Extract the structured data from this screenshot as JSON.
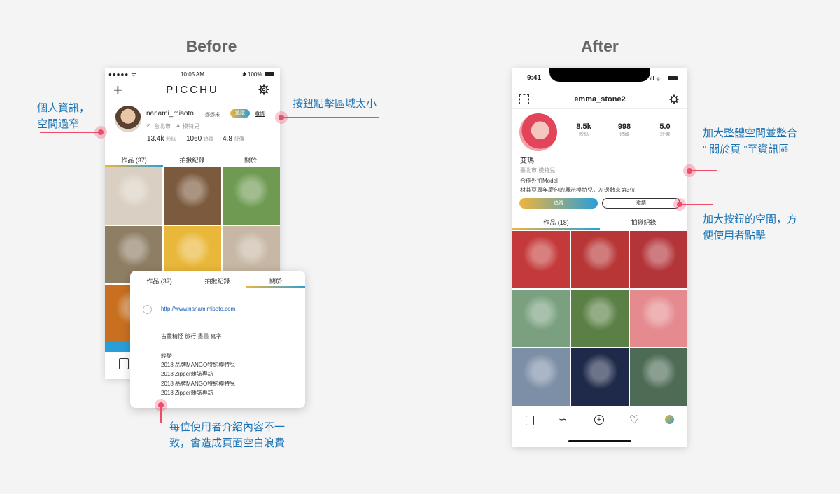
{
  "headings": {
    "before": "Before",
    "after": "After"
  },
  "before": {
    "status_time": "10:05 AM",
    "status_battery": "100%",
    "app_title": "PICCHU",
    "username": "nanami_misoto",
    "nickname": "娜娜米",
    "follow_label": "追蹤",
    "invite_label": "邀請",
    "location": "台北市",
    "role": "模特兒",
    "stats": [
      {
        "value": "13.4k",
        "label": "粉絲"
      },
      {
        "value": "1060",
        "label": "追蹤"
      },
      {
        "value": "4.8",
        "label": "評價"
      }
    ],
    "tabs": [
      "作品 (37)",
      "拍揪紀錄",
      "關於"
    ],
    "photo_colors": [
      "#d9cfc2",
      "#7b5a3d",
      "#6f9a52",
      "#8e7e64",
      "#e9b73a",
      "#c7b7a4",
      "#c8701f"
    ],
    "about_card": {
      "tabs": [
        "作品 (37)",
        "拍揪紀錄",
        "關於"
      ],
      "url": "http://www.nanamimisoto.com",
      "tags": "古靈精怪 旅行 畫畫 寫字",
      "history_title": "經歷",
      "history": [
        "2018 品牌MANGO特約模特兒",
        "2018 Zipper雜誌專訪",
        "2018 品牌MANGO特約模特兒",
        "2018 Zipper雜誌專訪"
      ]
    }
  },
  "after": {
    "status_time": "9:41",
    "username": "emma_stone2",
    "stats": [
      {
        "value": "8.5k",
        "label": "粉絲"
      },
      {
        "value": "998",
        "label": "追蹤"
      },
      {
        "value": "5.0",
        "label": "評價"
      }
    ],
    "name": "艾瑪",
    "location_role": "臺北市 模特兒",
    "bio1": "合作外拍Model",
    "bio2": "材其亞周年慶包的展示模特兒，左邊數來第3位",
    "follow_label": "追蹤",
    "invite_label": "邀請",
    "tabs": [
      "作品 (18)",
      "拍揪紀錄"
    ],
    "photo_colors": [
      "#c43a3a",
      "#b83636",
      "#b3353a",
      "#7aa07f",
      "#5b8046",
      "#e58a8e",
      "#7d8fa6",
      "#1f2a4a",
      "#4d6b55"
    ]
  },
  "annotations": {
    "a1_line1": "個人資訊，",
    "a1_line2": "空間過窄",
    "a2": "按鈕點擊區域太小",
    "a3_line1": "每位使用者介紹內容不一",
    "a3_line2": "致，會造成頁面空白浪費",
    "a4_line1": "加大整體空間並整合",
    "a4_line2": "” 關於頁 ”至資訊區",
    "a5_line1": "加大按鈕的空間，方",
    "a5_line2": "便使用者點擊"
  }
}
